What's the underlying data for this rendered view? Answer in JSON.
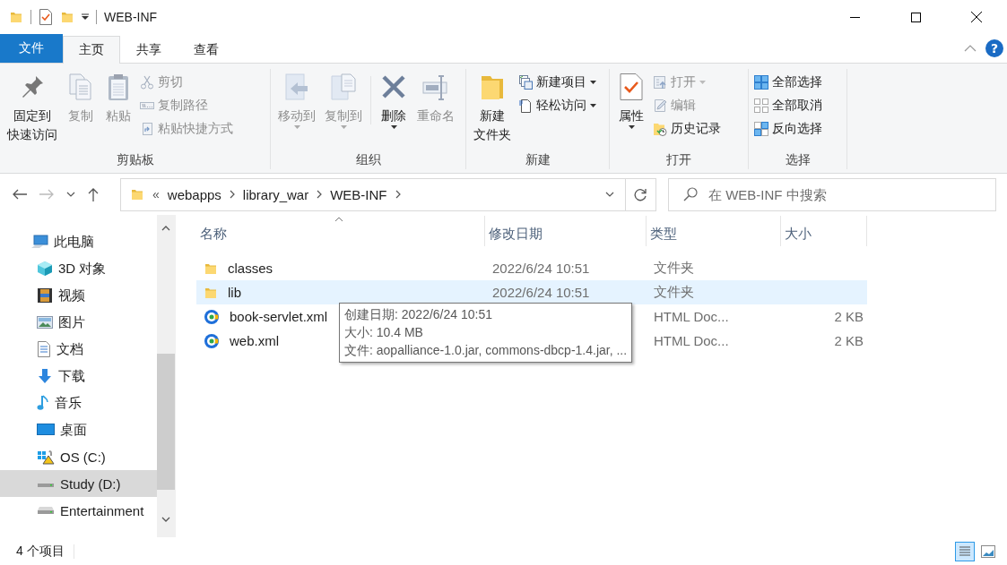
{
  "title_bar": {
    "title": "WEB-INF"
  },
  "tabs": [
    {
      "label": "文件",
      "kind": "file",
      "selected": false
    },
    {
      "label": "主页",
      "kind": "tab",
      "selected": true
    },
    {
      "label": "共享",
      "kind": "tab",
      "selected": false
    },
    {
      "label": "查看",
      "kind": "tab",
      "selected": false
    }
  ],
  "help": {
    "label": "?"
  },
  "ribbon": {
    "groups": [
      {
        "label": "剪贴板",
        "columns": [
          {
            "kind": "large",
            "lines": [
              "固定到",
              "快速访问"
            ],
            "disabled": false,
            "dropdown": false
          },
          {
            "kind": "large",
            "label": "复制",
            "disabled": true,
            "dropdown": false
          },
          {
            "kind": "large",
            "label": "粘贴",
            "disabled": true,
            "dropdown": false
          },
          {
            "kind": "stack",
            "items": [
              {
                "label": "剪切",
                "disabled": true,
                "dropdown": false
              },
              {
                "label": "复制路径",
                "disabled": true,
                "dropdown": false
              },
              {
                "label": "粘贴快捷方式",
                "disabled": true,
                "dropdown": false
              }
            ]
          }
        ]
      },
      {
        "label": "组织",
        "columns": [
          {
            "kind": "large",
            "label": "移动到",
            "disabled": true,
            "dropdown": true
          },
          {
            "kind": "large",
            "label": "复制到",
            "disabled": true,
            "dropdown": true
          },
          {
            "kind": "large",
            "label": "删除",
            "disabled": false,
            "dropdown": true
          },
          {
            "kind": "large",
            "label": "重命名",
            "disabled": true,
            "dropdown": false
          }
        ]
      },
      {
        "label": "新建",
        "columns": [
          {
            "kind": "large",
            "lines": [
              "新建",
              "文件夹"
            ],
            "disabled": false,
            "dropdown": false
          },
          {
            "kind": "stack",
            "items": [
              {
                "label": "新建项目",
                "disabled": false,
                "dropdown": true
              },
              {
                "label": "轻松访问",
                "disabled": false,
                "dropdown": true
              }
            ]
          }
        ]
      },
      {
        "label": "打开",
        "columns": [
          {
            "kind": "large",
            "label": "属性",
            "disabled": false,
            "dropdown": true
          },
          {
            "kind": "stack",
            "items": [
              {
                "label": "打开",
                "disabled": true,
                "dropdown": true
              },
              {
                "label": "编辑",
                "disabled": true,
                "dropdown": false
              },
              {
                "label": "历史记录",
                "disabled": false,
                "dropdown": false
              }
            ]
          }
        ]
      },
      {
        "label": "选择",
        "columns": [
          {
            "kind": "stack",
            "items": [
              {
                "label": "全部选择",
                "disabled": false,
                "dropdown": false
              },
              {
                "label": "全部取消",
                "disabled": false,
                "dropdown": false
              },
              {
                "label": "反向选择",
                "disabled": false,
                "dropdown": false
              }
            ]
          }
        ]
      }
    ]
  },
  "address_bar": {
    "overflow": "«",
    "crumbs": [
      "webapps",
      "library_war",
      "WEB-INF"
    ]
  },
  "search": {
    "placeholder": "在 WEB-INF 中搜索"
  },
  "nav_pane": {
    "items": [
      {
        "label": "此电脑",
        "selected": false,
        "children": [
          {
            "label": "3D 对象",
            "selected": false
          },
          {
            "label": "视频",
            "selected": false
          },
          {
            "label": "图片",
            "selected": false
          },
          {
            "label": "文档",
            "selected": false
          },
          {
            "label": "下载",
            "selected": false
          },
          {
            "label": "音乐",
            "selected": false
          },
          {
            "label": "桌面",
            "selected": false
          },
          {
            "label": "OS (C:)",
            "selected": false
          },
          {
            "label": "Study (D:)",
            "selected": true
          },
          {
            "label": "Entertainment",
            "selected": false
          }
        ]
      }
    ]
  },
  "file_list": {
    "columns": [
      {
        "label": "名称",
        "sorted": true
      },
      {
        "label": "修改日期",
        "sorted": false
      },
      {
        "label": "类型",
        "sorted": false
      },
      {
        "label": "大小",
        "sorted": false
      }
    ],
    "rows": [
      {
        "kind": "folder",
        "name": "classes",
        "modified": "2022/6/24 10:51",
        "type": "文件夹",
        "selected": false
      },
      {
        "kind": "folder",
        "name": "lib",
        "modified": "2022/6/24 10:51",
        "type": "文件夹",
        "selected": true
      },
      {
        "kind": "file",
        "name": "book-servlet.xml",
        "type": "HTML Doc...",
        "size": "2 KB",
        "selected": false
      },
      {
        "kind": "file",
        "name": "web.xml",
        "type": "HTML Doc...",
        "size": "2 KB",
        "selected": false
      }
    ]
  },
  "tooltip": {
    "lines": [
      "创建日期: 2022/6/24 10:51",
      "大小: 10.4 MB",
      "文件: aopalliance-1.0.jar, commons-dbcp-1.4.jar, ..."
    ]
  },
  "status_bar": {
    "count": "4 个项目",
    "views": [
      {
        "kind": "details",
        "selected": true
      },
      {
        "kind": "large-icons",
        "selected": false
      }
    ]
  }
}
